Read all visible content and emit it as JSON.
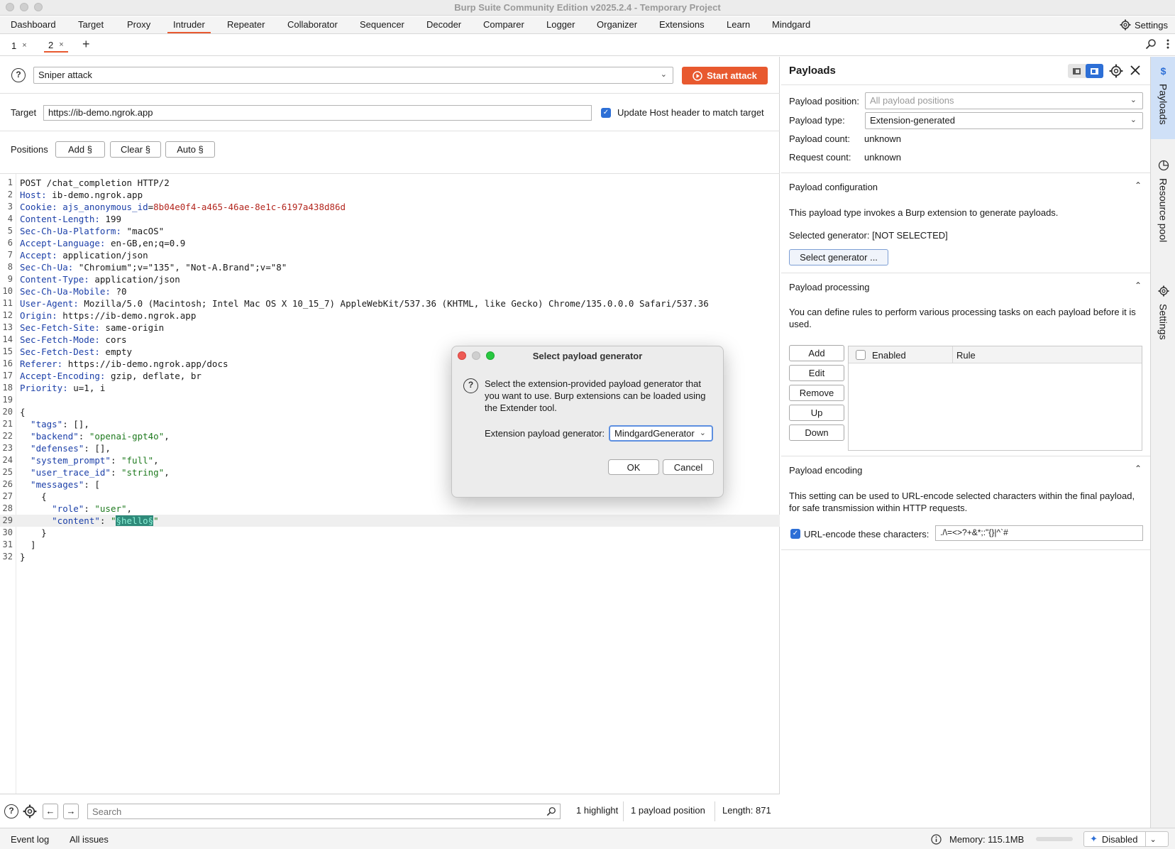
{
  "window": {
    "title": "Burp Suite Community Edition v2025.2.4 - Temporary Project"
  },
  "menu": {
    "items": [
      "Dashboard",
      "Target",
      "Proxy",
      "Intruder",
      "Repeater",
      "Collaborator",
      "Sequencer",
      "Decoder",
      "Comparer",
      "Logger",
      "Organizer",
      "Extensions",
      "Learn",
      "Mindgard"
    ],
    "active": "Intruder",
    "settings_label": "Settings"
  },
  "tabs": [
    {
      "label": "1",
      "close": "×"
    },
    {
      "label": "2",
      "close": "×"
    }
  ],
  "tab_add": "+",
  "attack": {
    "type": "Sniper attack",
    "start_label": "Start attack"
  },
  "target": {
    "label": "Target",
    "url": "https://ib-demo.ngrok.app",
    "update_host_label": "Update Host header to match target",
    "update_host_checked": true
  },
  "positions": {
    "label": "Positions",
    "add": "Add §",
    "clear": "Clear §",
    "auto": "Auto §"
  },
  "request_lines": [
    {
      "n": "1",
      "parts": [
        {
          "t": "POST /chat_completion HTTP/2",
          "c": ""
        }
      ]
    },
    {
      "n": "2",
      "parts": [
        {
          "t": "Host:",
          "c": "k"
        },
        {
          "t": " ib-demo.ngrok.app",
          "c": ""
        }
      ]
    },
    {
      "n": "3",
      "parts": [
        {
          "t": "Cookie:",
          "c": "k"
        },
        {
          "t": " ajs_anonymous_id",
          "c": "k"
        },
        {
          "t": "=",
          "c": ""
        },
        {
          "t": "8b04e0f4-a465-46ae-8e1c-6197a438d86d",
          "c": "v"
        }
      ]
    },
    {
      "n": "4",
      "parts": [
        {
          "t": "Content-Length:",
          "c": "k"
        },
        {
          "t": " 199",
          "c": ""
        }
      ]
    },
    {
      "n": "5",
      "parts": [
        {
          "t": "Sec-Ch-Ua-Platform:",
          "c": "k"
        },
        {
          "t": " \"macOS\"",
          "c": ""
        }
      ]
    },
    {
      "n": "6",
      "parts": [
        {
          "t": "Accept-Language:",
          "c": "k"
        },
        {
          "t": " en-GB,en;q=0.9",
          "c": ""
        }
      ]
    },
    {
      "n": "7",
      "parts": [
        {
          "t": "Accept:",
          "c": "k"
        },
        {
          "t": " application/json",
          "c": ""
        }
      ]
    },
    {
      "n": "8",
      "parts": [
        {
          "t": "Sec-Ch-Ua:",
          "c": "k"
        },
        {
          "t": " \"Chromium\";v=\"135\", \"Not-A.Brand\";v=\"8\"",
          "c": ""
        }
      ]
    },
    {
      "n": "9",
      "parts": [
        {
          "t": "Content-Type:",
          "c": "k"
        },
        {
          "t": " application/json",
          "c": ""
        }
      ]
    },
    {
      "n": "10",
      "parts": [
        {
          "t": "Sec-Ch-Ua-Mobile:",
          "c": "k"
        },
        {
          "t": " ?0",
          "c": ""
        }
      ]
    },
    {
      "n": "11",
      "parts": [
        {
          "t": "User-Agent:",
          "c": "k"
        },
        {
          "t": " Mozilla/5.0 (Macintosh; Intel Mac OS X 10_15_7) AppleWebKit/537.36 (KHTML, like Gecko) Chrome/135.0.0.0 Safari/537.36",
          "c": ""
        }
      ]
    },
    {
      "n": "12",
      "parts": [
        {
          "t": "Origin:",
          "c": "k"
        },
        {
          "t": " https://ib-demo.ngrok.app",
          "c": ""
        }
      ]
    },
    {
      "n": "13",
      "parts": [
        {
          "t": "Sec-Fetch-Site:",
          "c": "k"
        },
        {
          "t": " same-origin",
          "c": ""
        }
      ]
    },
    {
      "n": "14",
      "parts": [
        {
          "t": "Sec-Fetch-Mode:",
          "c": "k"
        },
        {
          "t": " cors",
          "c": ""
        }
      ]
    },
    {
      "n": "15",
      "parts": [
        {
          "t": "Sec-Fetch-Dest:",
          "c": "k"
        },
        {
          "t": " empty",
          "c": ""
        }
      ]
    },
    {
      "n": "16",
      "parts": [
        {
          "t": "Referer:",
          "c": "k"
        },
        {
          "t": " https://ib-demo.ngrok.app/docs",
          "c": ""
        }
      ]
    },
    {
      "n": "17",
      "parts": [
        {
          "t": "Accept-Encoding:",
          "c": "k"
        },
        {
          "t": " gzip, deflate, br",
          "c": ""
        }
      ]
    },
    {
      "n": "18",
      "parts": [
        {
          "t": "Priority:",
          "c": "k"
        },
        {
          "t": " u=1, i",
          "c": ""
        }
      ]
    },
    {
      "n": "19",
      "parts": []
    },
    {
      "n": "20",
      "parts": [
        {
          "t": "{",
          "c": ""
        }
      ]
    },
    {
      "n": "21",
      "parts": [
        {
          "t": "  \"tags\"",
          "c": "k"
        },
        {
          "t": ": [],",
          "c": ""
        }
      ]
    },
    {
      "n": "22",
      "parts": [
        {
          "t": "  \"backend\"",
          "c": "k"
        },
        {
          "t": ": ",
          "c": ""
        },
        {
          "t": "\"openai-gpt4o\"",
          "c": "s"
        },
        {
          "t": ",",
          "c": ""
        }
      ]
    },
    {
      "n": "23",
      "parts": [
        {
          "t": "  \"defenses\"",
          "c": "k"
        },
        {
          "t": ": [],",
          "c": ""
        }
      ]
    },
    {
      "n": "24",
      "parts": [
        {
          "t": "  \"system_prompt\"",
          "c": "k"
        },
        {
          "t": ": ",
          "c": ""
        },
        {
          "t": "\"full\"",
          "c": "s"
        },
        {
          "t": ",",
          "c": ""
        }
      ]
    },
    {
      "n": "25",
      "parts": [
        {
          "t": "  \"user_trace_id\"",
          "c": "k"
        },
        {
          "t": ": ",
          "c": ""
        },
        {
          "t": "\"string\"",
          "c": "s"
        },
        {
          "t": ",",
          "c": ""
        }
      ]
    },
    {
      "n": "26",
      "parts": [
        {
          "t": "  \"messages\"",
          "c": "k"
        },
        {
          "t": ": [",
          "c": ""
        }
      ]
    },
    {
      "n": "27",
      "parts": [
        {
          "t": "    {",
          "c": ""
        }
      ]
    },
    {
      "n": "28",
      "parts": [
        {
          "t": "      \"role\"",
          "c": "k"
        },
        {
          "t": ": ",
          "c": ""
        },
        {
          "t": "\"user\"",
          "c": "s"
        },
        {
          "t": ",",
          "c": ""
        }
      ]
    },
    {
      "n": "29",
      "parts": [
        {
          "t": "      \"content\"",
          "c": "k"
        },
        {
          "t": ": ",
          "c": ""
        },
        {
          "t": "\"",
          "c": "s"
        },
        {
          "t": "§hello§",
          "c": "mark"
        },
        {
          "t": "\"",
          "c": "s"
        }
      ],
      "highlight": true
    },
    {
      "n": "30",
      "parts": [
        {
          "t": "    }",
          "c": ""
        }
      ]
    },
    {
      "n": "31",
      "parts": [
        {
          "t": "  ]",
          "c": ""
        }
      ]
    },
    {
      "n": "32",
      "parts": [
        {
          "t": "}",
          "c": ""
        }
      ]
    }
  ],
  "editor_footer": {
    "search_placeholder": "Search",
    "highlights": "1 highlight",
    "payload_positions": "1 payload position",
    "length": "Length: 871"
  },
  "payloads": {
    "title": "Payloads",
    "position_label": "Payload position:",
    "position_value": "All payload positions",
    "type_label": "Payload type:",
    "type_value": "Extension-generated",
    "count_label": "Payload count:",
    "count_value": "unknown",
    "request_label": "Request count:",
    "request_value": "unknown"
  },
  "configuration": {
    "title": "Payload configuration",
    "description": "This payload type invokes a Burp extension to generate payloads.",
    "selected": "Selected generator: [NOT SELECTED]",
    "select_button": "Select generator ..."
  },
  "processing": {
    "title": "Payload processing",
    "description": "You can define rules to perform various processing tasks on each payload before it is used.",
    "buttons": [
      "Add",
      "Edit",
      "Remove",
      "Up",
      "Down"
    ],
    "col_enabled": "Enabled",
    "col_rule": "Rule"
  },
  "encoding": {
    "title": "Payload encoding",
    "description": "This setting can be used to URL-encode selected characters within the final payload, for safe transmission within HTTP requests.",
    "checkbox_label": "URL-encode these characters:",
    "chars": "./\\=<>?+&*;:\"{}|^`#"
  },
  "sidebar": {
    "tabs": [
      "Payloads",
      "Resource pool",
      "Settings"
    ]
  },
  "dialog": {
    "title": "Select payload generator",
    "message": "Select the extension-provided payload generator that you want to use. Burp extensions can be loaded using the Extender tool.",
    "field_label": "Extension payload generator:",
    "field_value": "MindgardGenerator",
    "ok": "OK",
    "cancel": "Cancel"
  },
  "statusbar": {
    "event_log": "Event log",
    "all_issues": "All issues",
    "memory": "Memory: 115.1MB",
    "ai_status": "Disabled"
  },
  "colors": {
    "accent": "#e8592f",
    "checkbox": "#2d6fd6",
    "header_key": "#1b3fa8",
    "cookie_value": "#b3261e",
    "json_string": "#1f7a1f"
  }
}
